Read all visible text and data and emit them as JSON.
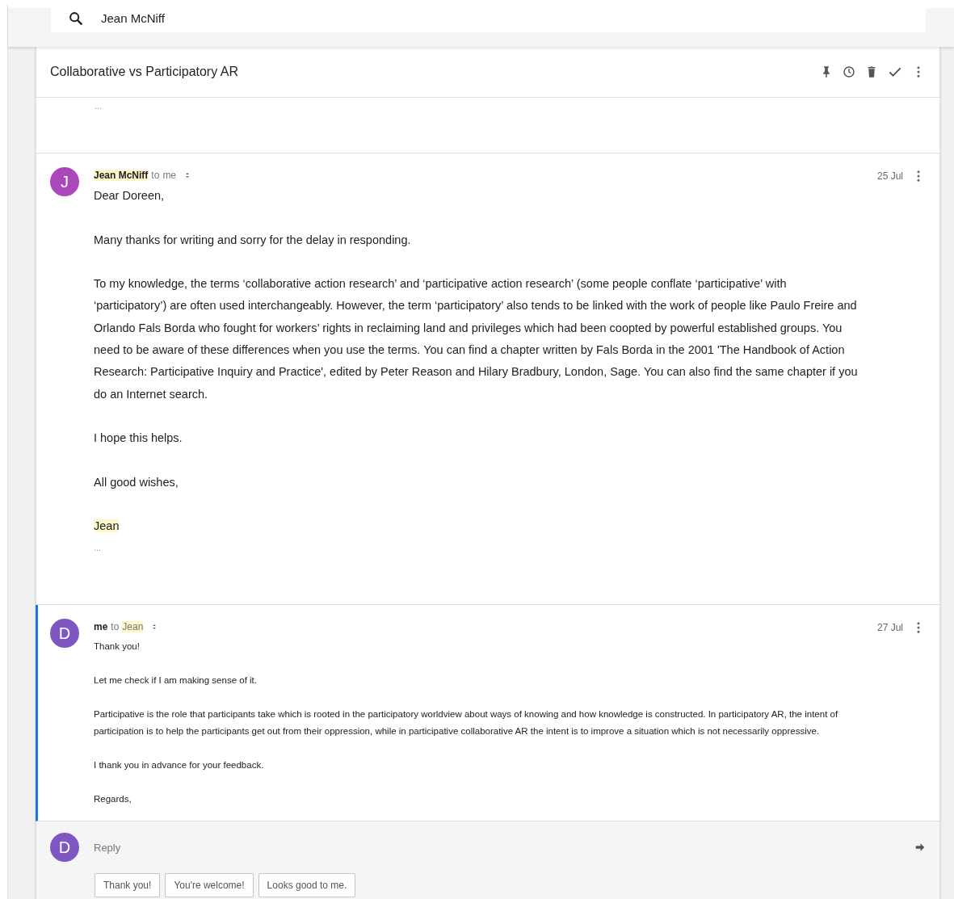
{
  "search": {
    "value": "Jean McNiff"
  },
  "thread": {
    "subject": "Collaborative vs Participatory AR",
    "collapsed_text": "..."
  },
  "messages": [
    {
      "kind": "large",
      "focused": false,
      "avatar": "J",
      "color": "#ab47bc",
      "sender": "Jean McNiff",
      "sender_highlighted": true,
      "to_prefix": "to",
      "recipient": "me",
      "recipient_highlighted": false,
      "date": "25 Jul",
      "trailing": "...",
      "paragraphs": [
        {
          "text": "Dear Doreen,",
          "highlighted": false
        },
        {
          "text": "Many thanks for writing and sorry for the delay in responding.",
          "highlighted": false
        },
        {
          "text": "To my knowledge, the terms ‘collaborative action research’ and ‘participative action research’ (some people conflate ‘participative’ with ‘participatory’) are often used interchangeably. However, the term ‘participatory’ also tends to be linked with the work of people like Paulo Freire and Orlando Fals Borda who fought for workers’ rights in reclaiming land and privileges which had been coopted by powerful established groups. You need to be aware of these differences when you use the terms. You can find a chapter written by Fals Borda in the 2001 'The Handbook of Action Research: Participative Inquiry and Practice', edited by Peter Reason and Hilary Bradbury, London, Sage. You can also find the same chapter if you do an Internet search.",
          "highlighted": false
        },
        {
          "text": "I hope this helps.",
          "highlighted": false
        },
        {
          "text": "All good wishes,",
          "highlighted": false
        },
        {
          "text": "Jean",
          "highlighted": true
        }
      ]
    },
    {
      "kind": "small",
      "focused": true,
      "avatar": "D",
      "color": "#7e57c2",
      "sender": "me",
      "sender_highlighted": false,
      "to_prefix": "to",
      "recipient": "Jean",
      "recipient_highlighted": true,
      "date": "27 Jul",
      "paragraphs": [
        {
          "text": "Thank you!",
          "highlighted": false
        },
        {
          "text": "Let me check if I am making sense of it.",
          "highlighted": false
        },
        {
          "text": "Participative is the role that participants take which is rooted in the participatory worldview about ways of knowing and how knowledge is constructed. In participatory AR, the intent of participation is to help the participants get out from their oppression, while in participative collaborative AR the intent is to improve a situation which is not necessarily oppressive.",
          "highlighted": false
        },
        {
          "text": "I thank you in advance for your feedback.",
          "highlighted": false
        },
        {
          "text": "Regards,",
          "highlighted": false
        }
      ]
    }
  ],
  "reply": {
    "avatar": "D",
    "color": "#7e57c2",
    "placeholder": "Reply",
    "suggestions": [
      "Thank you!",
      "You're welcome!",
      "Looks good to me."
    ]
  }
}
